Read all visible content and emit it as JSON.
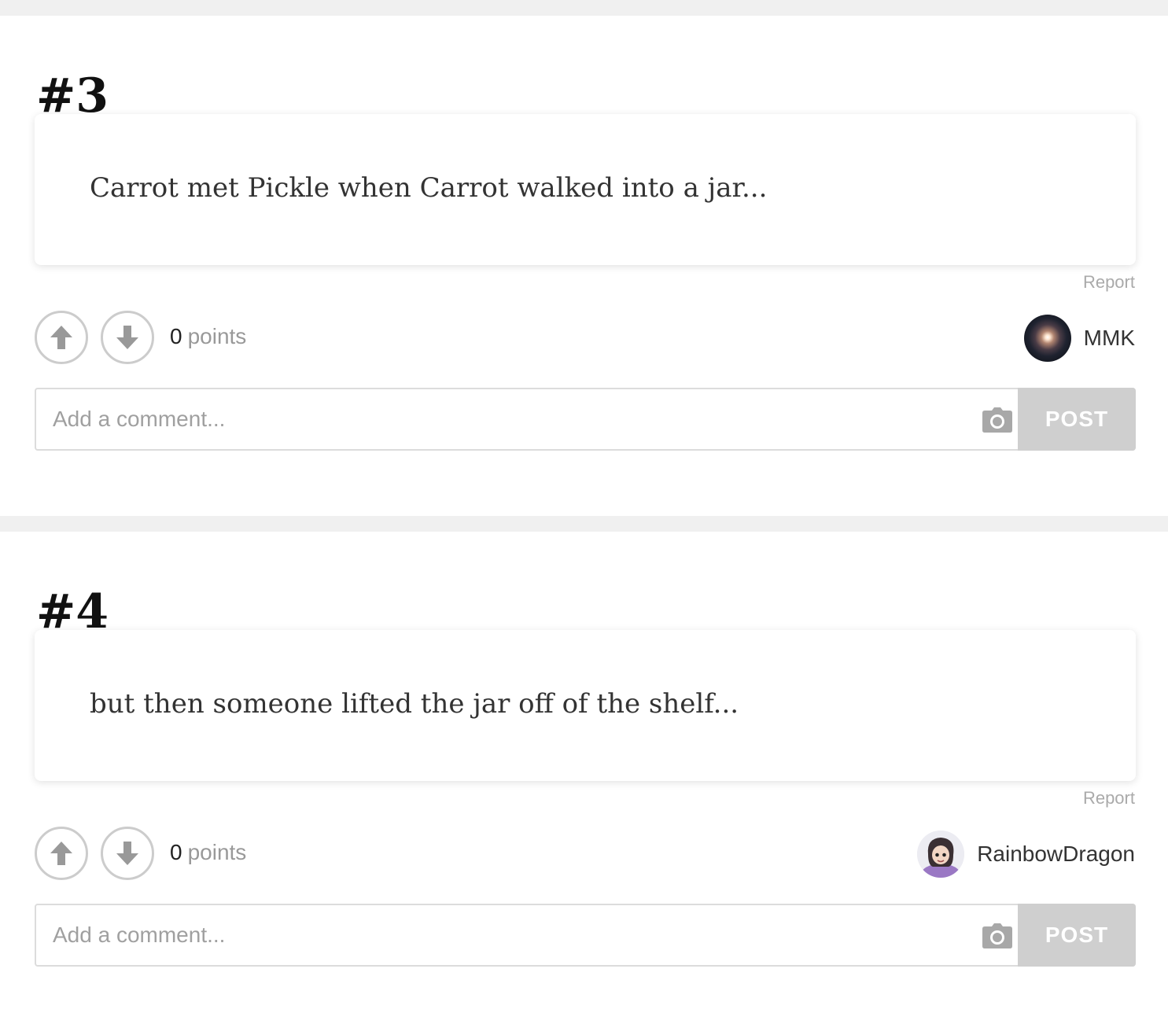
{
  "entries": [
    {
      "number": "#3",
      "text": "Carrot met Pickle when Carrot walked into a jar...",
      "report_label": "Report",
      "points_value": "0",
      "points_label": "points",
      "author": "MMK",
      "comment_placeholder": "Add a comment...",
      "post_label": "POST"
    },
    {
      "number": "#4",
      "text": "but then someone lifted the jar off of the shelf...",
      "report_label": "Report",
      "points_value": "0",
      "points_label": "points",
      "author": "RainbowDragon",
      "comment_placeholder": "Add a comment...",
      "post_label": "POST"
    }
  ],
  "colors": {
    "divider": "#f0f0f0",
    "post_button": "#cfcfcf",
    "vote_border": "#cccccc",
    "muted_text": "#999999"
  },
  "icons": {
    "upvote": "arrow-up-icon",
    "downvote": "arrow-down-icon",
    "camera": "camera-icon"
  }
}
